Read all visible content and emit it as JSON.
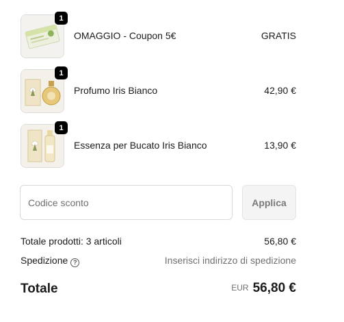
{
  "items": [
    {
      "name": "OMAGGIO - Coupon 5€",
      "price": "GRATIS",
      "quantity": "1",
      "thumbnail": "coupon-image"
    },
    {
      "name": "Profumo Iris Bianco",
      "price": "42,90 €",
      "quantity": "1",
      "thumbnail": "perfume-bottle-image"
    },
    {
      "name": "Essenza per Bucato Iris Bianco",
      "price": "13,90 €",
      "quantity": "1",
      "thumbnail": "laundry-essence-bottle-image"
    }
  ],
  "discount": {
    "placeholder": "Codice sconto",
    "value": "",
    "apply_label": "Applica"
  },
  "summary": {
    "subtotal_label": "Totale prodotti: 3 articoli",
    "subtotal_value": "56,80 €",
    "shipping_label": "Spedizione",
    "shipping_icon": "help-icon",
    "shipping_value": "Inserisci indirizzo di spedizione",
    "total_label": "Totale",
    "currency": "EUR",
    "total_value": "56,80 €"
  },
  "colors": {
    "text": "#1a1a1a",
    "muted": "#707070",
    "badge": "#000000",
    "border": "#d9d9d9",
    "button_bg": "#f4f4f4"
  }
}
